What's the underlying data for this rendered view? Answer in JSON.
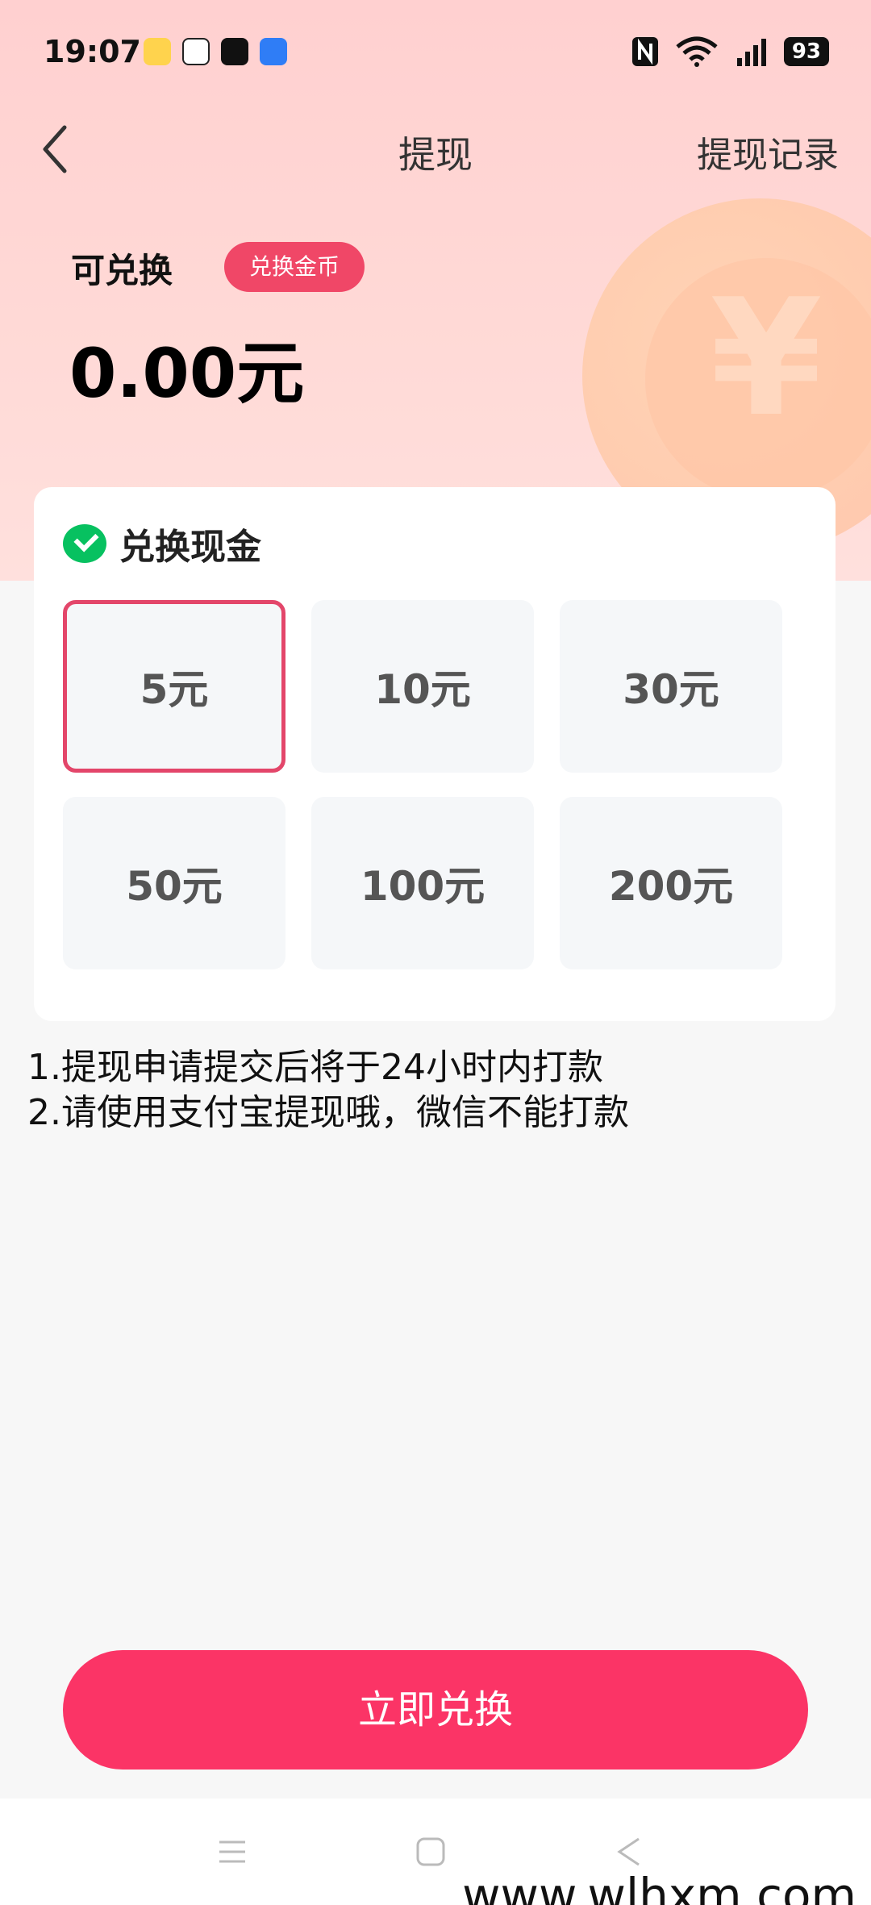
{
  "status_bar": {
    "time": "19:07",
    "battery": "93"
  },
  "nav": {
    "title": "提现",
    "right_link": "提现记录"
  },
  "balance": {
    "label": "可兑换",
    "exchange_coin_button": "兑换金币",
    "amount": "0.00元"
  },
  "card": {
    "title": "兑换现金",
    "options": [
      "5元",
      "10元",
      "30元",
      "50元",
      "100元",
      "200元"
    ],
    "selected_index": 0
  },
  "notes": {
    "line1": "1.提现申请提交后将于24小时内打款",
    "line2": "2.请使用支付宝提现哦，微信不能打款"
  },
  "action_button": "立即兑换",
  "watermark": "www.wlhxm.com",
  "colors": {
    "accent": "#fb3466",
    "badge": "#f04767",
    "selected_border": "#e3466a",
    "wechat_green": "#07c160"
  }
}
